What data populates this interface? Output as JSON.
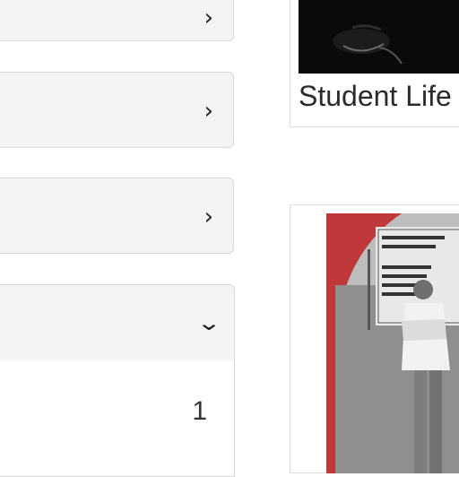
{
  "facets": [
    {
      "chevron": "›",
      "icon": "chevron-right-icon"
    },
    {
      "chevron": "›",
      "icon": "chevron-right-icon"
    },
    {
      "chevron": "›",
      "icon": "chevron-right-icon"
    }
  ],
  "open_facet": {
    "chevron": "⌄",
    "icon": "chevron-down-icon",
    "count": "1"
  },
  "cards": [
    {
      "caption": "Student Life",
      "image": "student-life-thumbnail"
    },
    {
      "caption": "",
      "image": "campus-sign-photo"
    }
  ],
  "colors": {
    "panel_bg": "#f4f4f4",
    "border": "#d7d7d7",
    "photo_border": "#c0393a"
  }
}
